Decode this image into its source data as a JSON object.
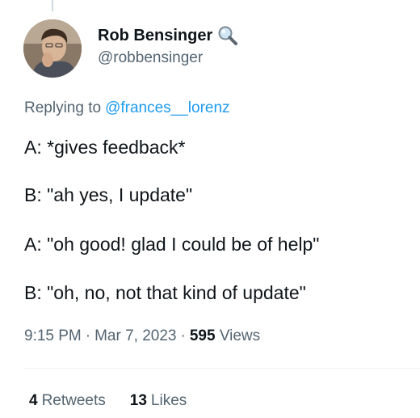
{
  "author": {
    "name": "Rob Bensinger",
    "handle": "@robbensinger",
    "badge_icon": "magnifying-glass-icon"
  },
  "reply": {
    "prefix": "Replying to",
    "mention": "@frances__lorenz"
  },
  "tweet": {
    "lines": [
      "A: *gives feedback*",
      "B: \"ah yes, I update\"",
      "A: \"oh good! glad I could be of help\"",
      "B: \"oh, no, not that kind of update\""
    ]
  },
  "meta": {
    "time": "9:15 PM",
    "separator": "·",
    "date": "Mar 7, 2023",
    "views_count": "595",
    "views_label": "Views"
  },
  "stats": {
    "retweets_count": "4",
    "retweets_label": "Retweets",
    "likes_count": "13",
    "likes_label": "Likes"
  },
  "colors": {
    "text": "#0f1419",
    "secondary": "#536471",
    "link": "#1d9bf0"
  }
}
